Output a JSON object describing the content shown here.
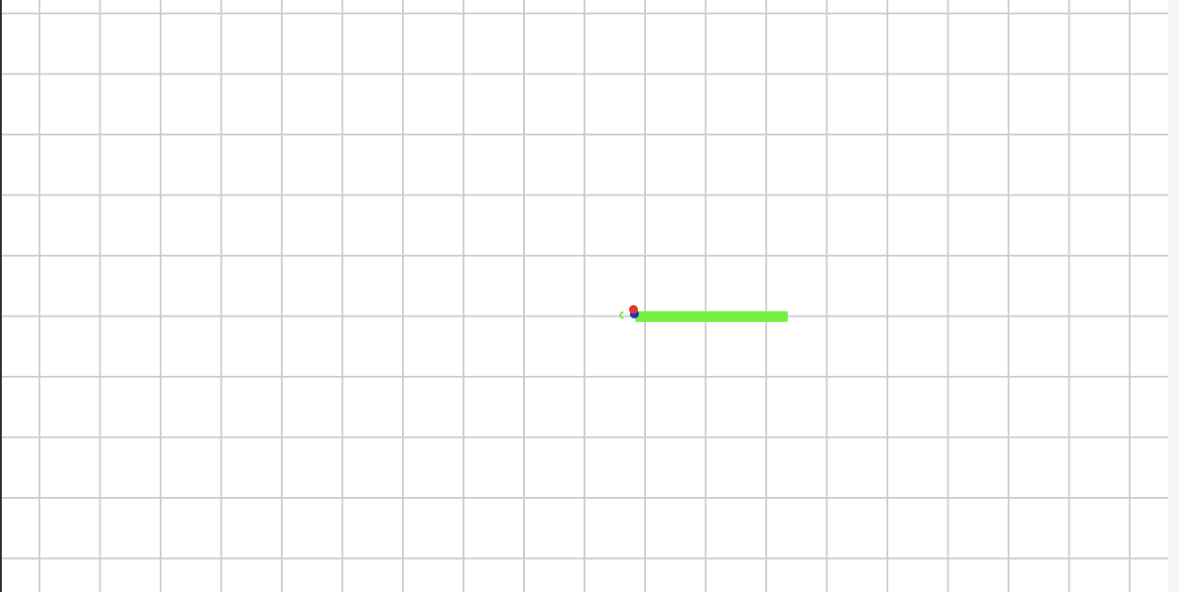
{
  "canvas": {
    "background": "#ffffff",
    "grid_color": "#cccccc",
    "left_edge_color": "#2b2b2b",
    "right_edge_color": "#f6f6f6"
  },
  "scene": {
    "track_color": "#77ee44",
    "robot_head_color": "#e03a2e",
    "robot_base_color": "#1f2fbf",
    "marker_color": "#77ee44"
  }
}
